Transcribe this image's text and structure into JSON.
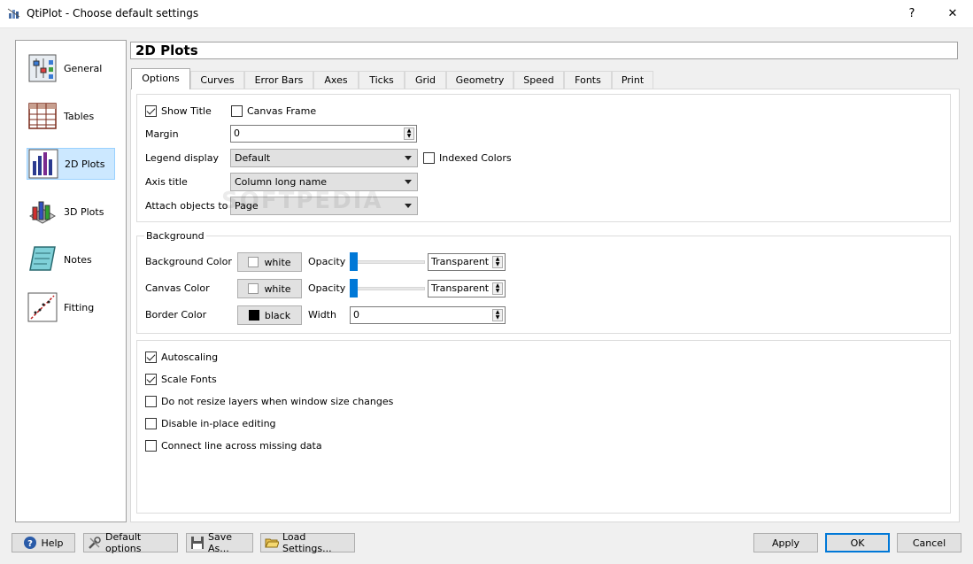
{
  "window": {
    "title": "QtiPlot - Choose default settings",
    "help_glyph": "?",
    "close_glyph": "✕"
  },
  "categories": [
    {
      "label": "General",
      "icon": "general-settings-icon"
    },
    {
      "label": "Tables",
      "icon": "table-icon"
    },
    {
      "label": "2D Plots",
      "icon": "bar-chart-2d-icon",
      "selected": true
    },
    {
      "label": "3D Plots",
      "icon": "bar-chart-3d-icon"
    },
    {
      "label": "Notes",
      "icon": "notes-icon"
    },
    {
      "label": "Fitting",
      "icon": "fitting-icon"
    }
  ],
  "page_title": "2D Plots",
  "tabs": [
    "Options",
    "Curves",
    "Error Bars",
    "Axes",
    "Ticks",
    "Grid",
    "Geometry",
    "Speed",
    "Fonts",
    "Print"
  ],
  "active_tab": "Options",
  "options": {
    "show_title": {
      "label": "Show Title",
      "checked": true
    },
    "canvas_frame": {
      "label": "Canvas Frame",
      "checked": false
    },
    "margin": {
      "label": "Margin",
      "value": "0"
    },
    "legend_display": {
      "label": "Legend display",
      "value": "Default"
    },
    "indexed_colors": {
      "label": "Indexed Colors",
      "checked": false
    },
    "axis_title": {
      "label": "Axis title",
      "value": "Column long name"
    },
    "attach_objects": {
      "label": "Attach objects to",
      "value": "Page"
    }
  },
  "background": {
    "group_title": "Background",
    "bg_color": {
      "label": "Background Color",
      "color_name": "white",
      "color": "#ffffff",
      "opacity_label": "Opacity",
      "opacity_value": "Transparent",
      "opacity_level": 0
    },
    "canvas_color": {
      "label": "Canvas Color",
      "color_name": "white",
      "color": "#ffffff",
      "opacity_label": "Opacity",
      "opacity_value": "Transparent",
      "opacity_level": 0
    },
    "border_color": {
      "label": "Border Color",
      "color_name": "black",
      "color": "#000000",
      "width_label": "Width",
      "width_value": "0"
    }
  },
  "misc": {
    "autoscaling": {
      "label": "Autoscaling",
      "checked": true
    },
    "scale_fonts": {
      "label": "Scale Fonts",
      "checked": true
    },
    "no_resize": {
      "label": "Do not resize layers when window size changes",
      "checked": false
    },
    "disable_inplace": {
      "label": "Disable in-place editing",
      "checked": false
    },
    "connect_missing": {
      "label": "Connect line across missing data",
      "checked": false
    }
  },
  "buttons": {
    "help": "Help",
    "default_options": "Default options",
    "save_as": "Save As...",
    "load_settings": "Load Settings...",
    "apply": "Apply",
    "ok": "OK",
    "cancel": "Cancel"
  },
  "watermark": "SOFTPEDIA",
  "colors": {
    "accent": "#0078d7",
    "selection": "#cce8ff"
  }
}
